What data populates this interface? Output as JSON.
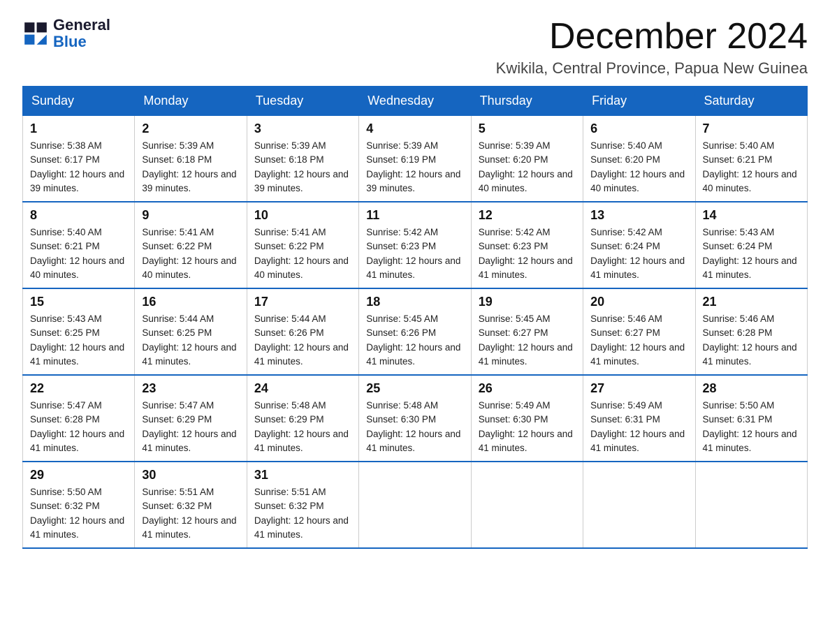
{
  "logo": {
    "text_general": "General",
    "text_blue": "Blue"
  },
  "title": "December 2024",
  "subtitle": "Kwikila, Central Province, Papua New Guinea",
  "weekdays": [
    "Sunday",
    "Monday",
    "Tuesday",
    "Wednesday",
    "Thursday",
    "Friday",
    "Saturday"
  ],
  "weeks": [
    [
      {
        "day": "1",
        "sunrise": "5:38 AM",
        "sunset": "6:17 PM",
        "daylight": "12 hours and 39 minutes."
      },
      {
        "day": "2",
        "sunrise": "5:39 AM",
        "sunset": "6:18 PM",
        "daylight": "12 hours and 39 minutes."
      },
      {
        "day": "3",
        "sunrise": "5:39 AM",
        "sunset": "6:18 PM",
        "daylight": "12 hours and 39 minutes."
      },
      {
        "day": "4",
        "sunrise": "5:39 AM",
        "sunset": "6:19 PM",
        "daylight": "12 hours and 39 minutes."
      },
      {
        "day": "5",
        "sunrise": "5:39 AM",
        "sunset": "6:20 PM",
        "daylight": "12 hours and 40 minutes."
      },
      {
        "day": "6",
        "sunrise": "5:40 AM",
        "sunset": "6:20 PM",
        "daylight": "12 hours and 40 minutes."
      },
      {
        "day": "7",
        "sunrise": "5:40 AM",
        "sunset": "6:21 PM",
        "daylight": "12 hours and 40 minutes."
      }
    ],
    [
      {
        "day": "8",
        "sunrise": "5:40 AM",
        "sunset": "6:21 PM",
        "daylight": "12 hours and 40 minutes."
      },
      {
        "day": "9",
        "sunrise": "5:41 AM",
        "sunset": "6:22 PM",
        "daylight": "12 hours and 40 minutes."
      },
      {
        "day": "10",
        "sunrise": "5:41 AM",
        "sunset": "6:22 PM",
        "daylight": "12 hours and 40 minutes."
      },
      {
        "day": "11",
        "sunrise": "5:42 AM",
        "sunset": "6:23 PM",
        "daylight": "12 hours and 41 minutes."
      },
      {
        "day": "12",
        "sunrise": "5:42 AM",
        "sunset": "6:23 PM",
        "daylight": "12 hours and 41 minutes."
      },
      {
        "day": "13",
        "sunrise": "5:42 AM",
        "sunset": "6:24 PM",
        "daylight": "12 hours and 41 minutes."
      },
      {
        "day": "14",
        "sunrise": "5:43 AM",
        "sunset": "6:24 PM",
        "daylight": "12 hours and 41 minutes."
      }
    ],
    [
      {
        "day": "15",
        "sunrise": "5:43 AM",
        "sunset": "6:25 PM",
        "daylight": "12 hours and 41 minutes."
      },
      {
        "day": "16",
        "sunrise": "5:44 AM",
        "sunset": "6:25 PM",
        "daylight": "12 hours and 41 minutes."
      },
      {
        "day": "17",
        "sunrise": "5:44 AM",
        "sunset": "6:26 PM",
        "daylight": "12 hours and 41 minutes."
      },
      {
        "day": "18",
        "sunrise": "5:45 AM",
        "sunset": "6:26 PM",
        "daylight": "12 hours and 41 minutes."
      },
      {
        "day": "19",
        "sunrise": "5:45 AM",
        "sunset": "6:27 PM",
        "daylight": "12 hours and 41 minutes."
      },
      {
        "day": "20",
        "sunrise": "5:46 AM",
        "sunset": "6:27 PM",
        "daylight": "12 hours and 41 minutes."
      },
      {
        "day": "21",
        "sunrise": "5:46 AM",
        "sunset": "6:28 PM",
        "daylight": "12 hours and 41 minutes."
      }
    ],
    [
      {
        "day": "22",
        "sunrise": "5:47 AM",
        "sunset": "6:28 PM",
        "daylight": "12 hours and 41 minutes."
      },
      {
        "day": "23",
        "sunrise": "5:47 AM",
        "sunset": "6:29 PM",
        "daylight": "12 hours and 41 minutes."
      },
      {
        "day": "24",
        "sunrise": "5:48 AM",
        "sunset": "6:29 PM",
        "daylight": "12 hours and 41 minutes."
      },
      {
        "day": "25",
        "sunrise": "5:48 AM",
        "sunset": "6:30 PM",
        "daylight": "12 hours and 41 minutes."
      },
      {
        "day": "26",
        "sunrise": "5:49 AM",
        "sunset": "6:30 PM",
        "daylight": "12 hours and 41 minutes."
      },
      {
        "day": "27",
        "sunrise": "5:49 AM",
        "sunset": "6:31 PM",
        "daylight": "12 hours and 41 minutes."
      },
      {
        "day": "28",
        "sunrise": "5:50 AM",
        "sunset": "6:31 PM",
        "daylight": "12 hours and 41 minutes."
      }
    ],
    [
      {
        "day": "29",
        "sunrise": "5:50 AM",
        "sunset": "6:32 PM",
        "daylight": "12 hours and 41 minutes."
      },
      {
        "day": "30",
        "sunrise": "5:51 AM",
        "sunset": "6:32 PM",
        "daylight": "12 hours and 41 minutes."
      },
      {
        "day": "31",
        "sunrise": "5:51 AM",
        "sunset": "6:32 PM",
        "daylight": "12 hours and 41 minutes."
      },
      null,
      null,
      null,
      null
    ]
  ]
}
